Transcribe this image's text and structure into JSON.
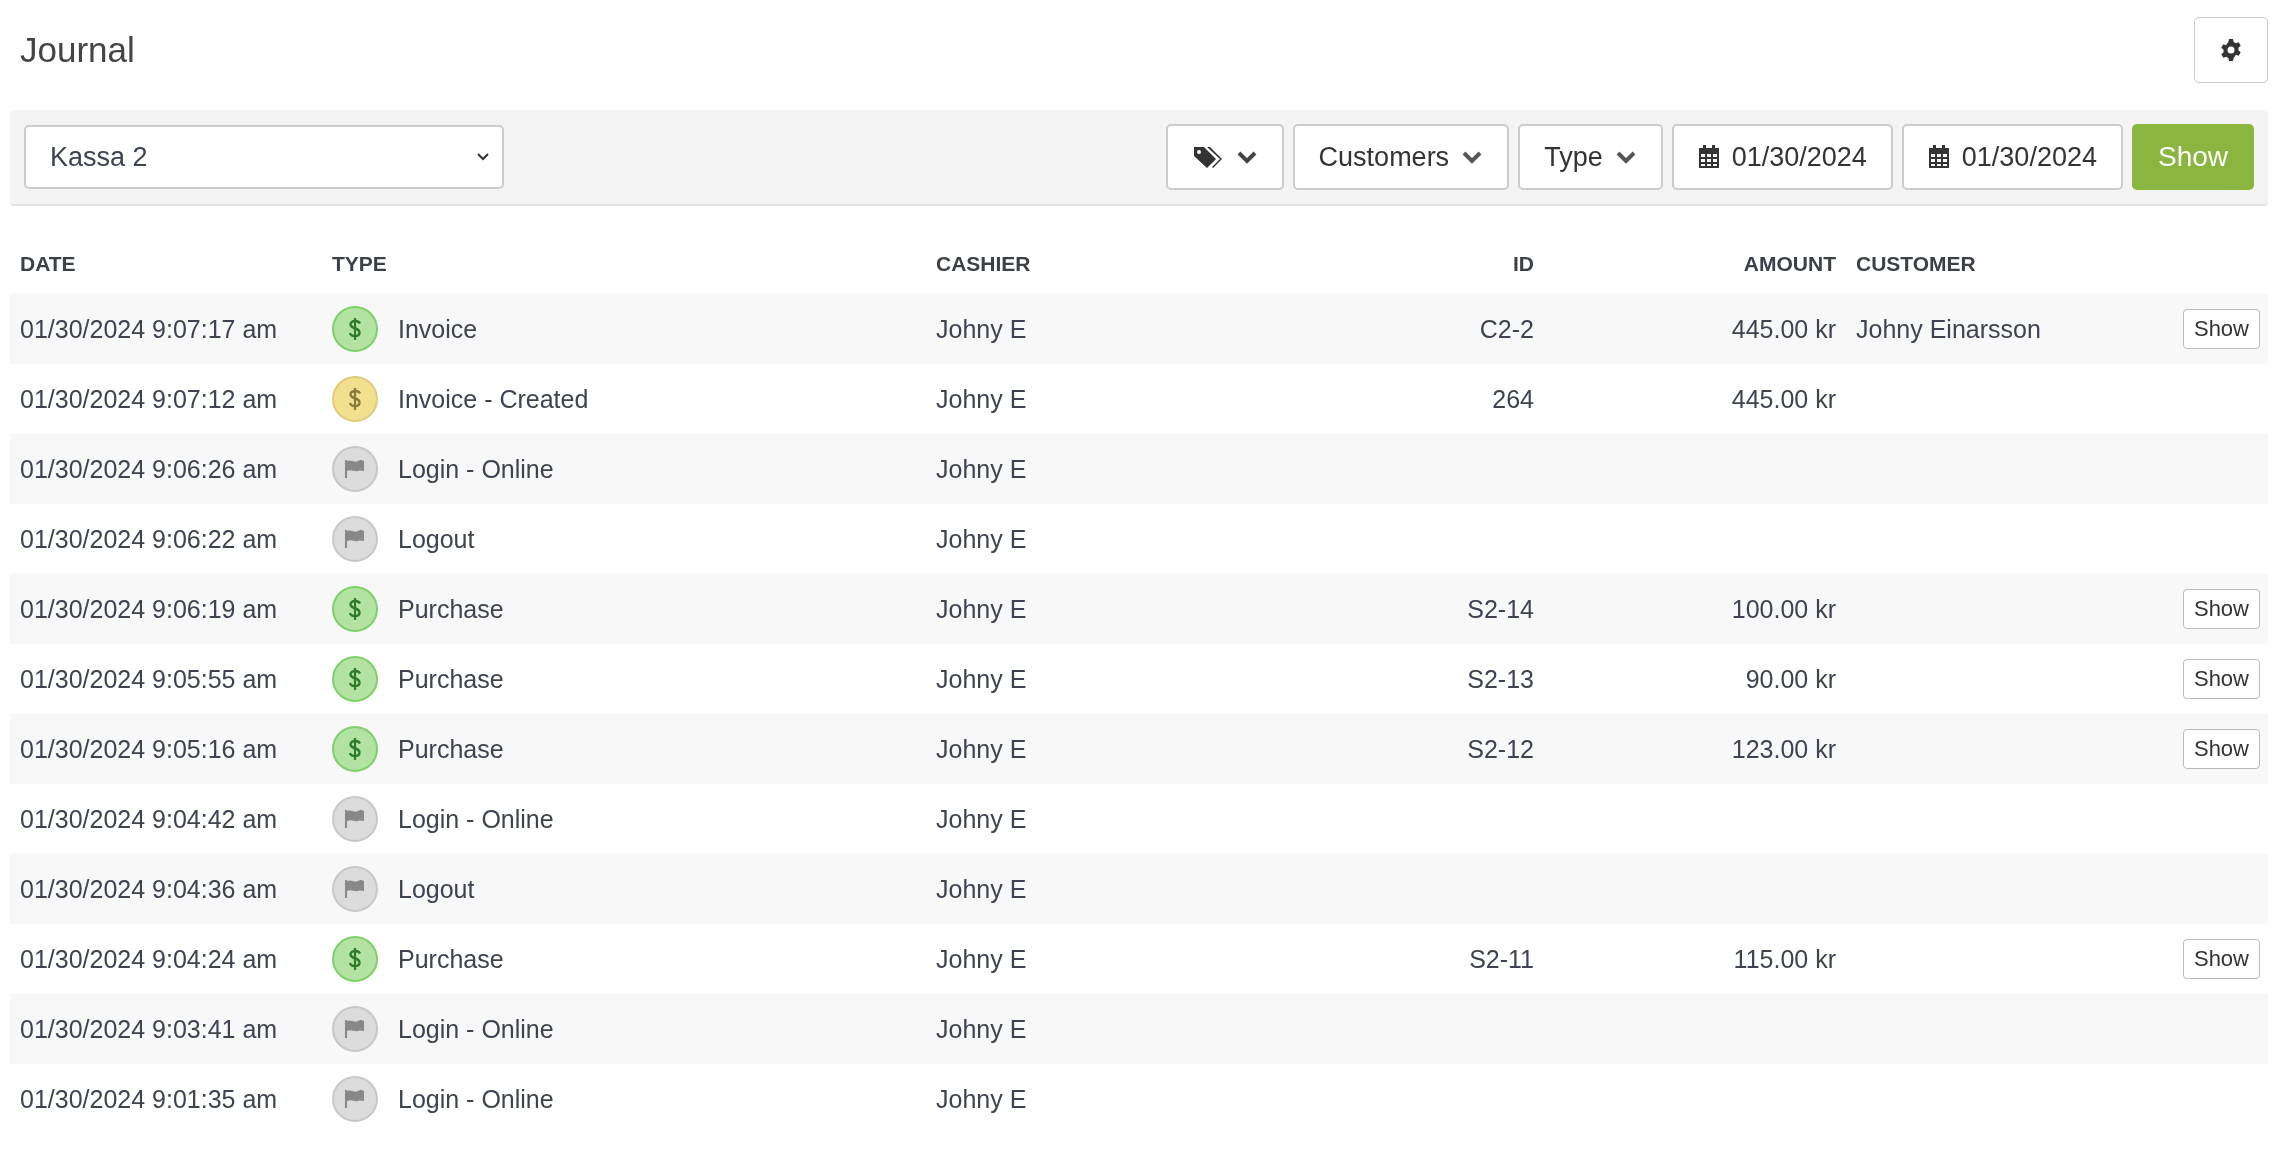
{
  "page": {
    "title": "Journal"
  },
  "toolbar": {
    "register_select": {
      "value": "Kassa 2"
    },
    "filters": [
      {
        "kind": "tags"
      },
      {
        "kind": "dropdown",
        "label": "Customers"
      },
      {
        "kind": "dropdown",
        "label": "Type"
      },
      {
        "kind": "date",
        "label": "01/30/2024"
      },
      {
        "kind": "date",
        "label": "01/30/2024"
      }
    ],
    "show_button": "Show"
  },
  "table": {
    "columns": [
      "DATE",
      "TYPE",
      "CASHIER",
      "ID",
      "AMOUNT",
      "CUSTOMER"
    ],
    "rows": [
      {
        "date": "01/30/2024 9:07:17 am",
        "type": {
          "label": "Invoice",
          "kind": "money",
          "color": "#b2e3a2"
        },
        "cashier": "Johny E",
        "id": "C2-2",
        "amount": "445.00 kr",
        "customer": "Johny Einarsson",
        "action": "Show"
      },
      {
        "date": "01/30/2024 9:07:12 am",
        "type": {
          "label": "Invoice - Created",
          "kind": "money",
          "color": "#f2e08e"
        },
        "cashier": "Johny E",
        "id": "264",
        "amount": "445.00 kr"
      },
      {
        "date": "01/30/2024 9:06:26 am",
        "type": {
          "label": "Login - Online",
          "kind": "flag",
          "color": "#dcdcdc"
        },
        "cashier": "Johny E"
      },
      {
        "date": "01/30/2024 9:06:22 am",
        "type": {
          "label": "Logout",
          "kind": "flag",
          "color": "#dcdcdc"
        },
        "cashier": "Johny E"
      },
      {
        "date": "01/30/2024 9:06:19 am",
        "type": {
          "label": "Purchase",
          "kind": "money",
          "color": "#b2e3a2"
        },
        "cashier": "Johny E",
        "id": "S2-14",
        "amount": "100.00 kr",
        "action": "Show"
      },
      {
        "date": "01/30/2024 9:05:55 am",
        "type": {
          "label": "Purchase",
          "kind": "money",
          "color": "#b2e3a2"
        },
        "cashier": "Johny E",
        "id": "S2-13",
        "amount": "90.00 kr",
        "action": "Show"
      },
      {
        "date": "01/30/2024 9:05:16 am",
        "type": {
          "label": "Purchase",
          "kind": "money",
          "color": "#b2e3a2"
        },
        "cashier": "Johny E",
        "id": "S2-12",
        "amount": "123.00 kr",
        "action": "Show"
      },
      {
        "date": "01/30/2024 9:04:42 am",
        "type": {
          "label": "Login - Online",
          "kind": "flag",
          "color": "#dcdcdc"
        },
        "cashier": "Johny E"
      },
      {
        "date": "01/30/2024 9:04:36 am",
        "type": {
          "label": "Logout",
          "kind": "flag",
          "color": "#dcdcdc"
        },
        "cashier": "Johny E"
      },
      {
        "date": "01/30/2024 9:04:24 am",
        "type": {
          "label": "Purchase",
          "kind": "money",
          "color": "#b2e3a2"
        },
        "cashier": "Johny E",
        "id": "S2-11",
        "amount": "115.00 kr",
        "action": "Show"
      },
      {
        "date": "01/30/2024 9:03:41 am",
        "type": {
          "label": "Login - Online",
          "kind": "flag",
          "color": "#dcdcdc"
        },
        "cashier": "Johny E"
      },
      {
        "date": "01/30/2024 9:01:35 am",
        "type": {
          "label": "Login - Online",
          "kind": "flag",
          "color": "#dcdcdc"
        },
        "cashier": "Johny E"
      }
    ]
  }
}
